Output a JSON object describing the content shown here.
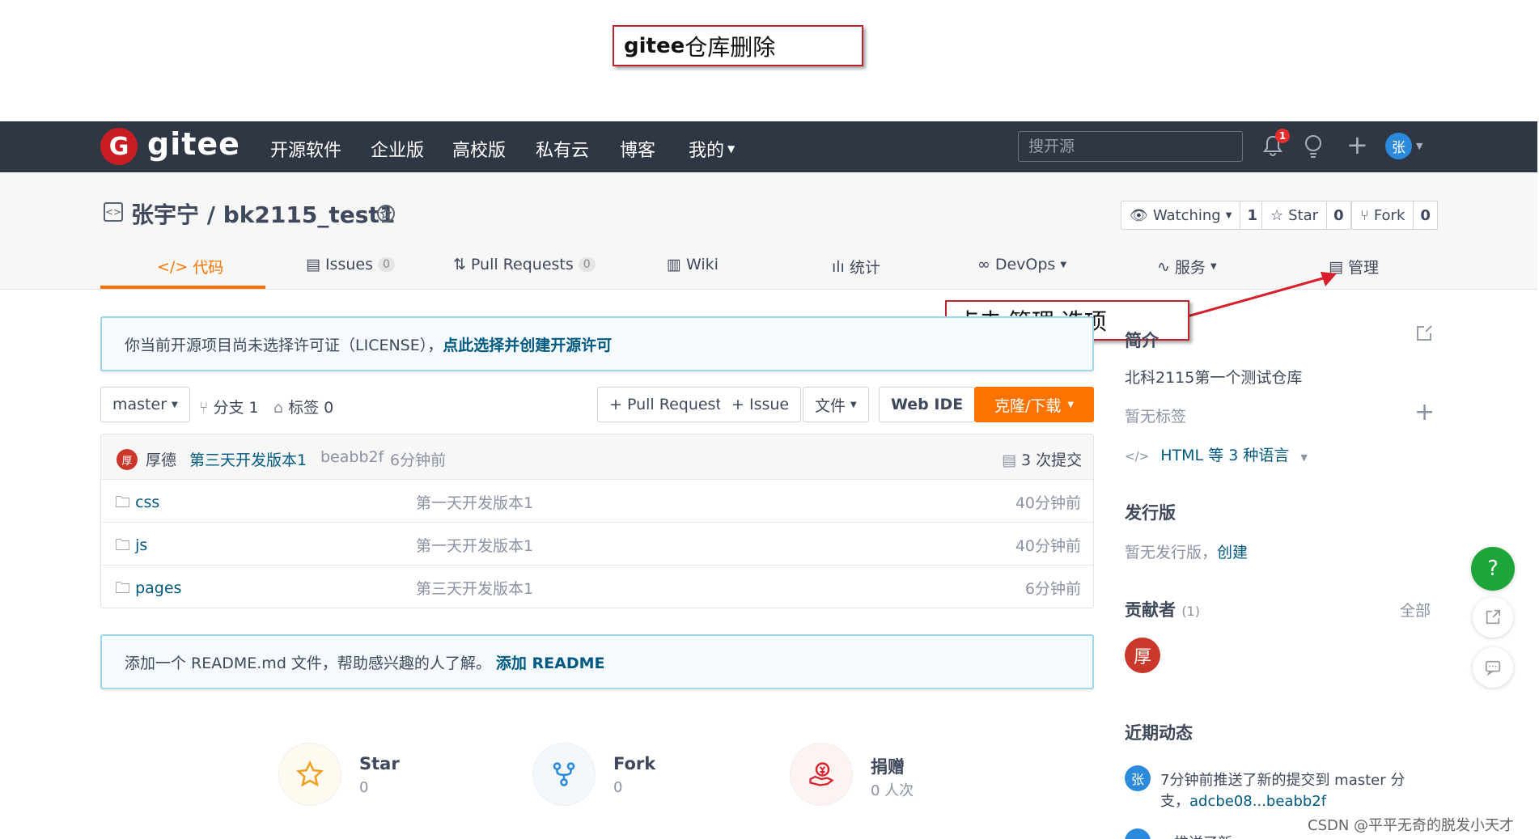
{
  "annotations": {
    "title_callout_brand": "gitee",
    "title_callout_rest": "仓库删除",
    "arrow_callout": "点击 管理 选项"
  },
  "topnav": {
    "logo_letter": "G",
    "logo_text": "gitee",
    "links": [
      "开源软件",
      "企业版",
      "高校版",
      "私有云",
      "博客",
      "我的"
    ],
    "search_placeholder": "搜开源",
    "notification_count": "1",
    "avatar": "张"
  },
  "repo": {
    "title": "张宇宁 / bk2115_test1",
    "watch_label": "Watching",
    "watch_count": "1",
    "star_label": "Star",
    "star_count": "0",
    "fork_label": "Fork",
    "fork_count": "0"
  },
  "tabs": [
    {
      "label": "代码"
    },
    {
      "label": "Issues",
      "count": "0"
    },
    {
      "label": "Pull Requests",
      "count": "0"
    },
    {
      "label": "Wiki"
    },
    {
      "label": "统计"
    },
    {
      "label": "DevOps"
    },
    {
      "label": "服务"
    },
    {
      "label": "管理"
    }
  ],
  "license_notice": {
    "text": "你当前开源项目尚未选择许可证（LICENSE），",
    "link": "点此选择并创建开源许可"
  },
  "toolbar": {
    "branch": "master",
    "branches": "分支 1",
    "tags": "标签 0",
    "pull_request": "+ Pull Request",
    "issue": "+ Issue",
    "file": "文件",
    "web_ide": "Web IDE",
    "clone": "克隆/下载"
  },
  "commit": {
    "avatar": "厚",
    "author": "厚德",
    "message": "第三天开发版本1",
    "hash": "beabb2f",
    "time": "6分钟前",
    "count": "3 次提交"
  },
  "files": [
    {
      "name": "css",
      "message": "第一天开发版本1",
      "time": "40分钟前"
    },
    {
      "name": "js",
      "message": "第一天开发版本1",
      "time": "40分钟前"
    },
    {
      "name": "pages",
      "message": "第三天开发版本1",
      "time": "6分钟前"
    }
  ],
  "readme_notice": {
    "text": "添加一个 README.md 文件，帮助感兴趣的人了解。",
    "link": "添加 README"
  },
  "footer_stats": [
    {
      "label": "Star",
      "value": "0"
    },
    {
      "label": "Fork",
      "value": "0"
    },
    {
      "label": "捐赠",
      "value": "0 人次"
    }
  ],
  "sidebar": {
    "intro_title": "简介",
    "description": "北科2115第一个测试仓库",
    "no_tags": "暂无标签",
    "languages": "HTML 等 3 种语言",
    "release_title": "发行版",
    "release_text": "暂无发行版，",
    "release_link": "创建",
    "contributors_title": "贡献者",
    "contributors_count": "(1)",
    "contributors_all": "全部",
    "contributor_avatar": "厚",
    "activity_title": "近期动态",
    "activity_avatar": "张",
    "activity_line1": "7分钟前推送了新的提交到 master 分",
    "activity_line2_prefix": "支，",
    "activity_line2_link": "adcbe08...beabb2f",
    "activity_line3": "...推送了新..."
  },
  "float_help": "?",
  "watermark": "CSDN @平平无奇的脱发小天才",
  "colors": {
    "accent_orange": "#fe7300",
    "nav_dark": "#2f3644",
    "link_blue": "#005980",
    "callout_red": "#c0202a",
    "help_green": "#1ea53a"
  }
}
